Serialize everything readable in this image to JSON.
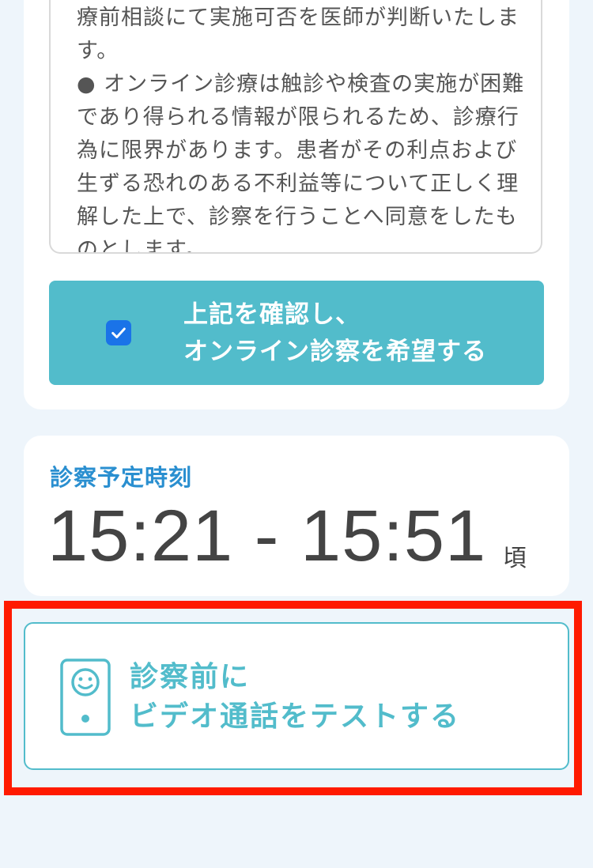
{
  "notice": {
    "text": "療前相談にて実施可否を医師が判断いたします。\n● オンライン診療は触診や検査の実施が困難であり得られる情報が限られるため、診療行為に限界があります。患者がその利点および生ずる恐れのある不利益等について正しく理解した上で、診察を行うことへ同意をしたものとします。"
  },
  "confirm": {
    "line1": "上記を確認し、",
    "line2": "オンライン診察を希望する",
    "checked": true
  },
  "schedule": {
    "title": "診察予定時刻",
    "time": "15:21 - 15:51",
    "suffix": "頃"
  },
  "video_test": {
    "line1": "診察前に",
    "line2": "ビデオ通話をテストする",
    "icon": "phone-smiley-icon"
  },
  "colors": {
    "accent": "#52bccb",
    "title_blue": "#2a8fd0",
    "highlight": "#ff1a00",
    "background": "#eef5fb"
  }
}
